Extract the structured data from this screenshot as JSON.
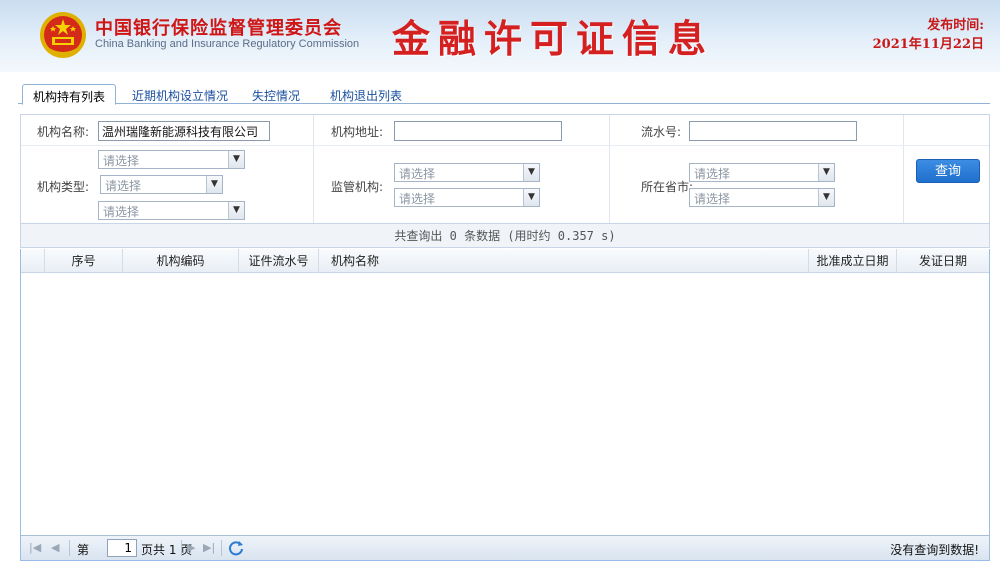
{
  "header": {
    "org_name_cn": "中国银行保险监督管理委员会",
    "org_name_en": "China Banking and Insurance Regulatory Commission",
    "title": "金融许可证信息",
    "publish_label": "发布时间:",
    "publish_date": "2021年11月22日",
    "emblem_icon": "national-emblem-icon"
  },
  "tabs": [
    {
      "label": "机构持有列表",
      "active": true
    },
    {
      "label": "近期机构设立情况",
      "active": false
    },
    {
      "label": "失控情况",
      "active": false
    },
    {
      "label": "机构退出列表",
      "active": false
    }
  ],
  "search": {
    "org_name_label": "机构名称:",
    "org_name_value": "温州瑞隆新能源科技有限公司",
    "org_address_label": "机构地址:",
    "org_address_value": "",
    "serial_label": "流水号:",
    "serial_value": "",
    "org_type_label": "机构类型:",
    "org_type_selects": [
      "请选择",
      "请选择",
      "请选择"
    ],
    "regulator_label": "监管机构:",
    "regulator_selects": [
      "请选择",
      "请选择"
    ],
    "province_label": "所在省市:",
    "province_selects": [
      "请选择",
      "请选择"
    ],
    "query_button": "查询"
  },
  "summary": "共查询出 0 条数据 (用时约 0.357 s)",
  "grid": {
    "columns": [
      "序号",
      "机构编码",
      "证件流水号",
      "机构名称",
      "批准成立日期",
      "发证日期"
    ],
    "rows": []
  },
  "pager": {
    "page_prefix": "第",
    "current_page": "1",
    "page_suffix": "页共 1 页",
    "no_data_text": "没有查询到数据!"
  },
  "colors": {
    "title_red": "#d42020",
    "button_blue": "#2a7bd8",
    "tab_link_blue": "#1a4fa0"
  }
}
